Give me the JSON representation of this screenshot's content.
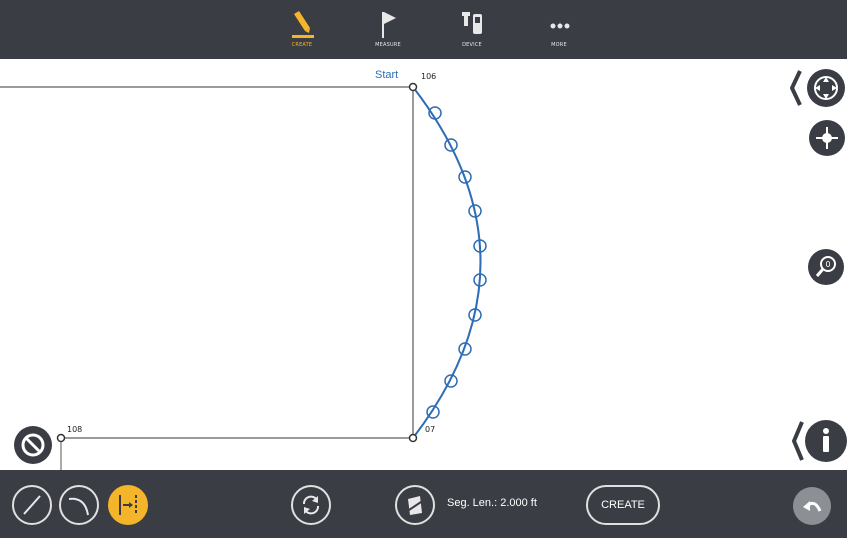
{
  "top_bar": {
    "tabs": [
      {
        "label": "CREATE",
        "icon": "pencil-icon",
        "active": true
      },
      {
        "label": "MEASURE",
        "icon": "flag-icon",
        "active": false
      },
      {
        "label": "DEVICE",
        "icon": "device-icon",
        "active": false
      },
      {
        "label": "MORE",
        "icon": "more-dots-icon",
        "active": false
      }
    ]
  },
  "canvas": {
    "start_label": "Start",
    "points": {
      "p106": "106",
      "p107": "07",
      "p108": "108"
    }
  },
  "bottom_bar": {
    "seg_len": "Seg. Len.: 2.000 ft",
    "create_label": "CREATE"
  },
  "colors": {
    "accent": "#f5b52a",
    "bar": "#3a3d44",
    "curve": "#2e6db4"
  }
}
